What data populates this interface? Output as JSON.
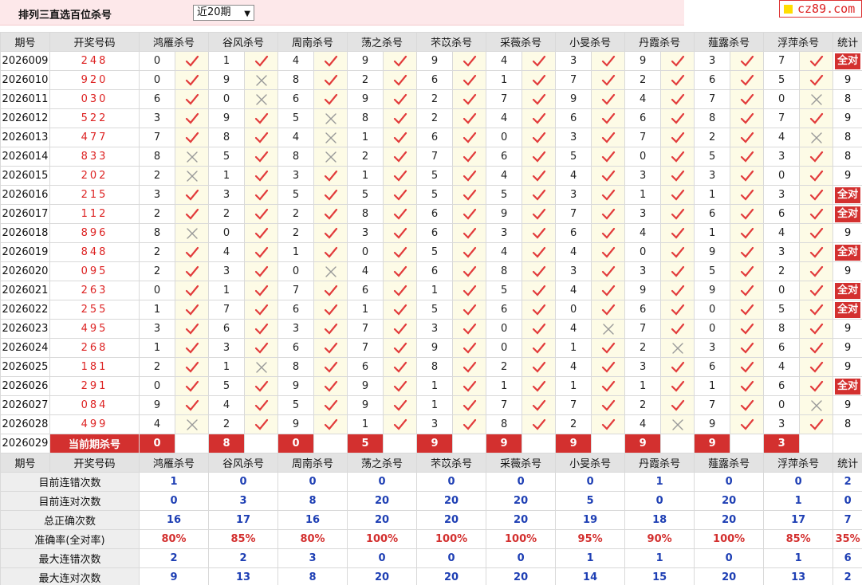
{
  "header": {
    "title": "排列三直选百位杀号",
    "period_selected": "近20期",
    "logo_text": "cz89.com"
  },
  "columns": {
    "issue": "期号",
    "draw": "开奖号码",
    "experts": [
      "鸿雁杀号",
      "谷风杀号",
      "周南杀号",
      "荡之杀号",
      "芣苡杀号",
      "采薇杀号",
      "小旻杀号",
      "丹霞杀号",
      "薤露杀号",
      "浮萍杀号"
    ],
    "stat": "统计"
  },
  "rows": [
    {
      "issue": "2026009",
      "draw": "248",
      "kills": [
        [
          0,
          1
        ],
        [
          1,
          1
        ],
        [
          4,
          1
        ],
        [
          9,
          1
        ],
        [
          9,
          1
        ],
        [
          4,
          1
        ],
        [
          3,
          1
        ],
        [
          9,
          1
        ],
        [
          3,
          1
        ],
        [
          7,
          1
        ]
      ],
      "stat": "全对"
    },
    {
      "issue": "2026010",
      "draw": "920",
      "kills": [
        [
          0,
          1
        ],
        [
          9,
          0
        ],
        [
          8,
          1
        ],
        [
          2,
          1
        ],
        [
          6,
          1
        ],
        [
          1,
          1
        ],
        [
          7,
          1
        ],
        [
          2,
          1
        ],
        [
          6,
          1
        ],
        [
          5,
          1
        ]
      ],
      "stat": "9"
    },
    {
      "issue": "2026011",
      "draw": "030",
      "kills": [
        [
          6,
          1
        ],
        [
          0,
          0
        ],
        [
          6,
          1
        ],
        [
          9,
          1
        ],
        [
          2,
          1
        ],
        [
          7,
          1
        ],
        [
          9,
          1
        ],
        [
          4,
          1
        ],
        [
          7,
          1
        ],
        [
          0,
          0
        ]
      ],
      "stat": "8"
    },
    {
      "issue": "2026012",
      "draw": "522",
      "kills": [
        [
          3,
          1
        ],
        [
          9,
          1
        ],
        [
          5,
          0
        ],
        [
          8,
          1
        ],
        [
          2,
          1
        ],
        [
          4,
          1
        ],
        [
          6,
          1
        ],
        [
          6,
          1
        ],
        [
          8,
          1
        ],
        [
          7,
          1
        ]
      ],
      "stat": "9"
    },
    {
      "issue": "2026013",
      "draw": "477",
      "kills": [
        [
          7,
          1
        ],
        [
          8,
          1
        ],
        [
          4,
          0
        ],
        [
          1,
          1
        ],
        [
          6,
          1
        ],
        [
          0,
          1
        ],
        [
          3,
          1
        ],
        [
          7,
          1
        ],
        [
          2,
          1
        ],
        [
          4,
          0
        ]
      ],
      "stat": "8"
    },
    {
      "issue": "2026014",
      "draw": "833",
      "kills": [
        [
          8,
          0
        ],
        [
          5,
          1
        ],
        [
          8,
          0
        ],
        [
          2,
          1
        ],
        [
          7,
          1
        ],
        [
          6,
          1
        ],
        [
          5,
          1
        ],
        [
          0,
          1
        ],
        [
          5,
          1
        ],
        [
          3,
          1
        ]
      ],
      "stat": "8"
    },
    {
      "issue": "2026015",
      "draw": "202",
      "kills": [
        [
          2,
          0
        ],
        [
          1,
          1
        ],
        [
          3,
          1
        ],
        [
          1,
          1
        ],
        [
          5,
          1
        ],
        [
          4,
          1
        ],
        [
          4,
          1
        ],
        [
          3,
          1
        ],
        [
          3,
          1
        ],
        [
          0,
          1
        ]
      ],
      "stat": "9"
    },
    {
      "issue": "2026016",
      "draw": "215",
      "kills": [
        [
          3,
          1
        ],
        [
          3,
          1
        ],
        [
          5,
          1
        ],
        [
          5,
          1
        ],
        [
          5,
          1
        ],
        [
          5,
          1
        ],
        [
          3,
          1
        ],
        [
          1,
          1
        ],
        [
          1,
          1
        ],
        [
          3,
          1
        ]
      ],
      "stat": "全对"
    },
    {
      "issue": "2026017",
      "draw": "112",
      "kills": [
        [
          2,
          1
        ],
        [
          2,
          1
        ],
        [
          2,
          1
        ],
        [
          8,
          1
        ],
        [
          6,
          1
        ],
        [
          9,
          1
        ],
        [
          7,
          1
        ],
        [
          3,
          1
        ],
        [
          6,
          1
        ],
        [
          6,
          1
        ]
      ],
      "stat": "全对"
    },
    {
      "issue": "2026018",
      "draw": "896",
      "kills": [
        [
          8,
          0
        ],
        [
          0,
          1
        ],
        [
          2,
          1
        ],
        [
          3,
          1
        ],
        [
          6,
          1
        ],
        [
          3,
          1
        ],
        [
          6,
          1
        ],
        [
          4,
          1
        ],
        [
          1,
          1
        ],
        [
          4,
          1
        ]
      ],
      "stat": "9"
    },
    {
      "issue": "2026019",
      "draw": "848",
      "kills": [
        [
          2,
          1
        ],
        [
          4,
          1
        ],
        [
          1,
          1
        ],
        [
          0,
          1
        ],
        [
          5,
          1
        ],
        [
          4,
          1
        ],
        [
          4,
          1
        ],
        [
          0,
          1
        ],
        [
          9,
          1
        ],
        [
          3,
          1
        ]
      ],
      "stat": "全对"
    },
    {
      "issue": "2026020",
      "draw": "095",
      "kills": [
        [
          2,
          1
        ],
        [
          3,
          1
        ],
        [
          0,
          0
        ],
        [
          4,
          1
        ],
        [
          6,
          1
        ],
        [
          8,
          1
        ],
        [
          3,
          1
        ],
        [
          3,
          1
        ],
        [
          5,
          1
        ],
        [
          2,
          1
        ]
      ],
      "stat": "9"
    },
    {
      "issue": "2026021",
      "draw": "263",
      "kills": [
        [
          0,
          1
        ],
        [
          1,
          1
        ],
        [
          7,
          1
        ],
        [
          6,
          1
        ],
        [
          1,
          1
        ],
        [
          5,
          1
        ],
        [
          4,
          1
        ],
        [
          9,
          1
        ],
        [
          9,
          1
        ],
        [
          0,
          1
        ]
      ],
      "stat": "全对"
    },
    {
      "issue": "2026022",
      "draw": "255",
      "kills": [
        [
          1,
          1
        ],
        [
          7,
          1
        ],
        [
          6,
          1
        ],
        [
          1,
          1
        ],
        [
          5,
          1
        ],
        [
          6,
          1
        ],
        [
          0,
          1
        ],
        [
          6,
          1
        ],
        [
          0,
          1
        ],
        [
          5,
          1
        ]
      ],
      "stat": "全对"
    },
    {
      "issue": "2026023",
      "draw": "495",
      "kills": [
        [
          3,
          1
        ],
        [
          6,
          1
        ],
        [
          3,
          1
        ],
        [
          7,
          1
        ],
        [
          3,
          1
        ],
        [
          0,
          1
        ],
        [
          4,
          0
        ],
        [
          7,
          1
        ],
        [
          0,
          1
        ],
        [
          8,
          1
        ]
      ],
      "stat": "9"
    },
    {
      "issue": "2026024",
      "draw": "268",
      "kills": [
        [
          1,
          1
        ],
        [
          3,
          1
        ],
        [
          6,
          1
        ],
        [
          7,
          1
        ],
        [
          9,
          1
        ],
        [
          0,
          1
        ],
        [
          1,
          1
        ],
        [
          2,
          0
        ],
        [
          3,
          1
        ],
        [
          6,
          1
        ]
      ],
      "stat": "9"
    },
    {
      "issue": "2026025",
      "draw": "181",
      "kills": [
        [
          2,
          1
        ],
        [
          1,
          0
        ],
        [
          8,
          1
        ],
        [
          6,
          1
        ],
        [
          8,
          1
        ],
        [
          2,
          1
        ],
        [
          4,
          1
        ],
        [
          3,
          1
        ],
        [
          6,
          1
        ],
        [
          4,
          1
        ]
      ],
      "stat": "9"
    },
    {
      "issue": "2026026",
      "draw": "291",
      "kills": [
        [
          0,
          1
        ],
        [
          5,
          1
        ],
        [
          9,
          1
        ],
        [
          9,
          1
        ],
        [
          1,
          1
        ],
        [
          1,
          1
        ],
        [
          1,
          1
        ],
        [
          1,
          1
        ],
        [
          1,
          1
        ],
        [
          6,
          1
        ]
      ],
      "stat": "全对"
    },
    {
      "issue": "2026027",
      "draw": "084",
      "kills": [
        [
          9,
          1
        ],
        [
          4,
          1
        ],
        [
          5,
          1
        ],
        [
          9,
          1
        ],
        [
          1,
          1
        ],
        [
          7,
          1
        ],
        [
          7,
          1
        ],
        [
          2,
          1
        ],
        [
          7,
          1
        ],
        [
          0,
          0
        ]
      ],
      "stat": "9"
    },
    {
      "issue": "2026028",
      "draw": "499",
      "kills": [
        [
          4,
          0
        ],
        [
          2,
          1
        ],
        [
          9,
          1
        ],
        [
          1,
          1
        ],
        [
          3,
          1
        ],
        [
          8,
          1
        ],
        [
          2,
          1
        ],
        [
          4,
          0
        ],
        [
          9,
          1
        ],
        [
          3,
          1
        ]
      ],
      "stat": "8"
    }
  ],
  "current": {
    "issue": "2026029",
    "label": "当前期杀号",
    "kills": [
      "0",
      "8",
      "0",
      "5",
      "9",
      "9",
      "9",
      "9",
      "9",
      "3"
    ]
  },
  "summary": [
    {
      "label": "目前连错次数",
      "values": [
        "1",
        "0",
        "0",
        "0",
        "0",
        "0",
        "0",
        "1",
        "0",
        "0"
      ],
      "stat": "2",
      "highlight": false
    },
    {
      "label": "目前连对次数",
      "values": [
        "0",
        "3",
        "8",
        "20",
        "20",
        "20",
        "5",
        "0",
        "20",
        "1"
      ],
      "stat": "0",
      "highlight": false
    },
    {
      "label": "总正确次数",
      "values": [
        "16",
        "17",
        "16",
        "20",
        "20",
        "20",
        "19",
        "18",
        "20",
        "17"
      ],
      "stat": "7",
      "highlight": false
    },
    {
      "label": "准确率(全对率)",
      "values": [
        "80%",
        "85%",
        "80%",
        "100%",
        "100%",
        "100%",
        "95%",
        "90%",
        "100%",
        "85%"
      ],
      "stat": "35%",
      "highlight": true
    },
    {
      "label": "最大连错次数",
      "values": [
        "2",
        "2",
        "3",
        "0",
        "0",
        "0",
        "1",
        "1",
        "0",
        "1"
      ],
      "stat": "6",
      "highlight": false
    },
    {
      "label": "最大连对次数",
      "values": [
        "9",
        "13",
        "8",
        "20",
        "20",
        "20",
        "14",
        "15",
        "20",
        "13"
      ],
      "stat": "2",
      "highlight": false
    }
  ],
  "icons": {
    "right": "check-icon",
    "wrong": "cross-icon"
  },
  "colors": {
    "accent_red": "#d3302f",
    "check_red": "#e23b3b",
    "cross_gray": "#999999",
    "stat_blue": "#1e3fb4",
    "mark_bg": "#fdfbe6"
  }
}
